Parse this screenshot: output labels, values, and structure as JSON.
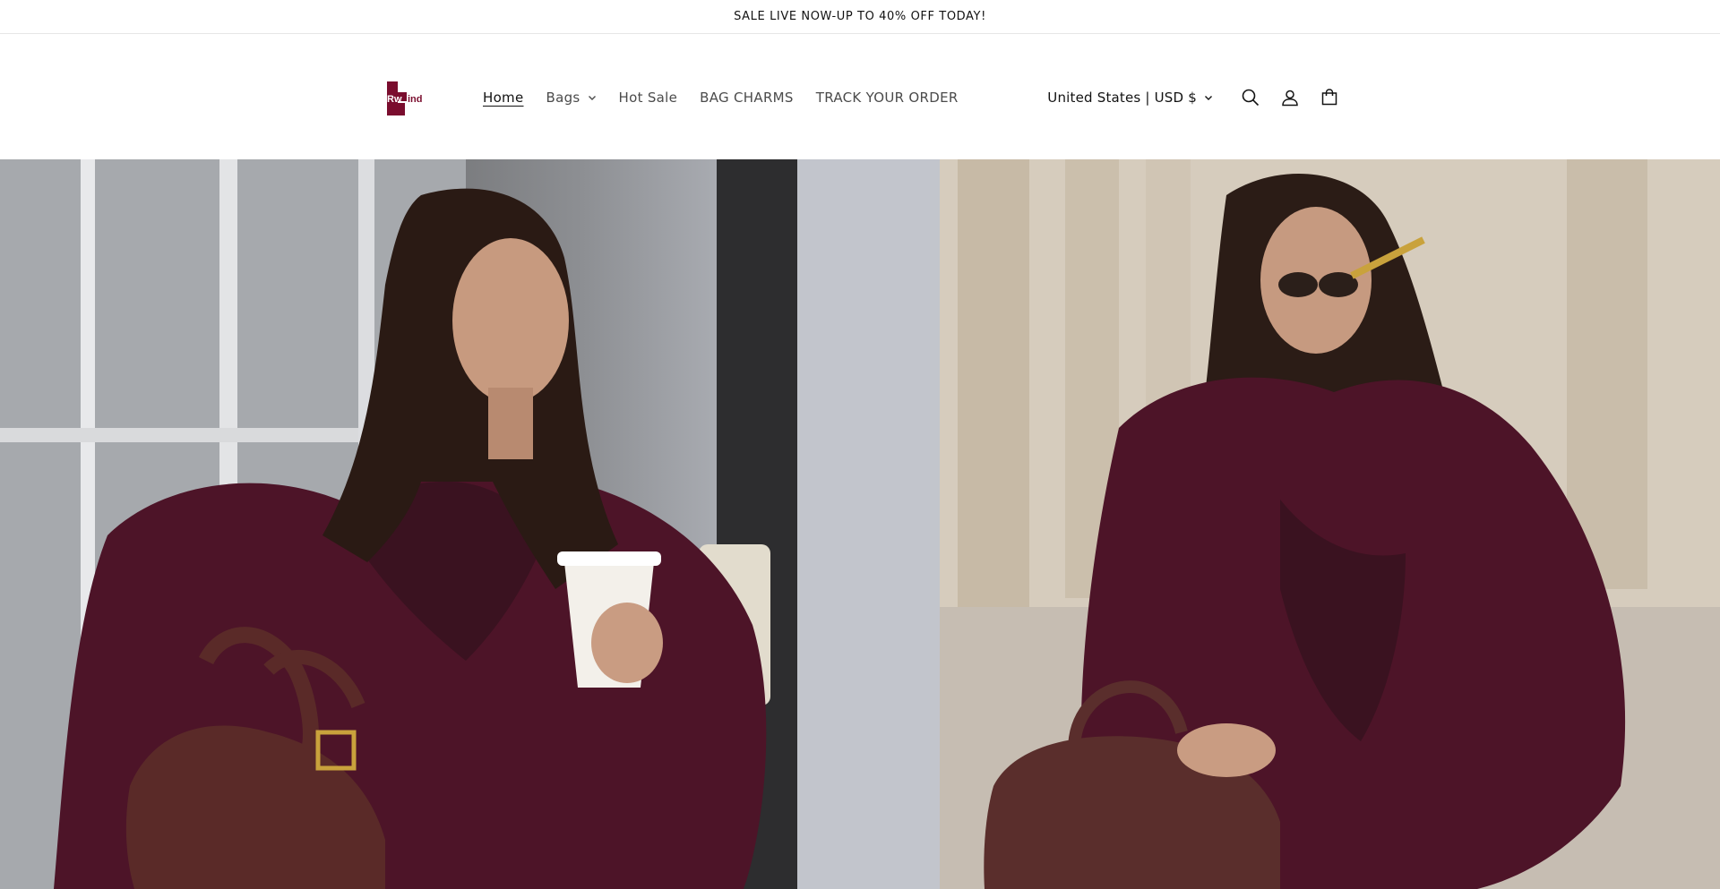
{
  "announcement": {
    "text": "SALE LIVE NOW-UP TO 40% OFF TODAY!"
  },
  "header": {
    "logo_text": "Rwind",
    "nav": [
      {
        "label": "Home",
        "active": true,
        "has_dropdown": false
      },
      {
        "label": "Bags",
        "active": false,
        "has_dropdown": true
      },
      {
        "label": "Hot Sale",
        "active": false,
        "has_dropdown": false
      },
      {
        "label": "BAG CHARMS",
        "active": false,
        "has_dropdown": false
      },
      {
        "label": "TRACK YOUR ORDER",
        "active": false,
        "has_dropdown": false
      }
    ],
    "country_selector": "United States | USD $",
    "icons": [
      "search-icon",
      "account-icon",
      "cart-icon"
    ]
  },
  "hero": {
    "images": [
      "model-in-burgundy-fur-coat-with-coffee",
      "model-in-burgundy-fur-coat-with-handbag"
    ]
  },
  "colors": {
    "brand": "#7a0d2e",
    "text": "#121212",
    "muted_text": "#4b4b4b",
    "coat": "#4d1428"
  }
}
